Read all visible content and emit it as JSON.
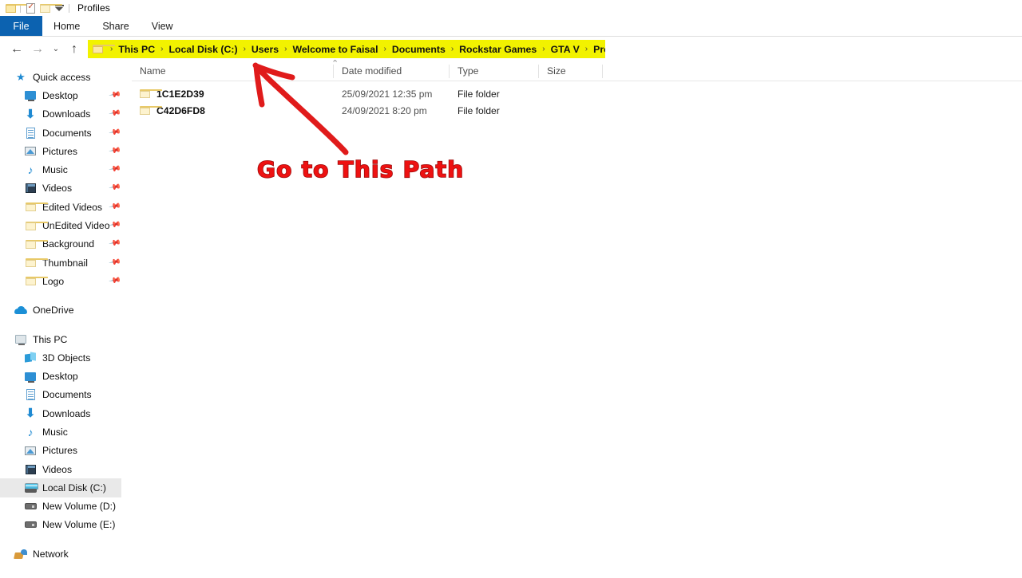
{
  "window": {
    "title": "Profiles",
    "quick_access_toolbar": [
      {
        "name": "folder-icon"
      },
      {
        "name": "properties-icon"
      },
      {
        "name": "new-folder-icon"
      },
      {
        "name": "customize-qat-chevron-icon"
      }
    ]
  },
  "ribbon": {
    "tabs": [
      {
        "label": "File",
        "active": true
      },
      {
        "label": "Home",
        "active": false
      },
      {
        "label": "Share",
        "active": false
      },
      {
        "label": "View",
        "active": false
      }
    ]
  },
  "navigation": {
    "back_icon": "←",
    "forward_icon": "→",
    "recent_icon": "⌄",
    "up_icon": "↑",
    "highlight_color": "#f2f200",
    "breadcrumb_separator": "›",
    "breadcrumbs": [
      {
        "label": "This PC"
      },
      {
        "label": "Local Disk (C:)"
      },
      {
        "label": "Users"
      },
      {
        "label": "Welcome to Faisal"
      },
      {
        "label": "Documents"
      },
      {
        "label": "Rockstar Games"
      },
      {
        "label": "GTA V"
      },
      {
        "label": "Profiles"
      }
    ]
  },
  "sidebar": {
    "groups": [
      {
        "root": {
          "label": "Quick access",
          "icon": "star-pin-icon",
          "selected": false
        },
        "items": [
          {
            "label": "Desktop",
            "icon": "desktop-monitor-icon",
            "pinned": true
          },
          {
            "label": "Downloads",
            "icon": "download-arrow-icon",
            "pinned": true
          },
          {
            "label": "Documents",
            "icon": "document-icon",
            "pinned": true
          },
          {
            "label": "Pictures",
            "icon": "picture-icon",
            "pinned": true
          },
          {
            "label": "Music",
            "icon": "music-note-icon",
            "pinned": true
          },
          {
            "label": "Videos",
            "icon": "video-film-icon",
            "pinned": true
          },
          {
            "label": "Edited Videos",
            "icon": "folder-icon",
            "pinned": true
          },
          {
            "label": "UnEdited Video",
            "icon": "folder-icon",
            "pinned": true
          },
          {
            "label": "Background",
            "icon": "folder-icon",
            "pinned": true
          },
          {
            "label": "Thumbnail",
            "icon": "folder-icon",
            "pinned": true
          },
          {
            "label": "Logo",
            "icon": "folder-icon",
            "pinned": true
          }
        ]
      },
      {
        "root": {
          "label": "OneDrive",
          "icon": "cloud-icon",
          "selected": false
        },
        "items": []
      },
      {
        "root": {
          "label": "This PC",
          "icon": "this-pc-monitor-icon",
          "selected": false
        },
        "items": [
          {
            "label": "3D Objects",
            "icon": "3d-objects-icon",
            "pinned": false
          },
          {
            "label": "Desktop",
            "icon": "desktop-monitor-icon",
            "pinned": false
          },
          {
            "label": "Documents",
            "icon": "document-icon",
            "pinned": false
          },
          {
            "label": "Downloads",
            "icon": "download-arrow-icon",
            "pinned": false
          },
          {
            "label": "Music",
            "icon": "music-note-icon",
            "pinned": false
          },
          {
            "label": "Pictures",
            "icon": "picture-icon",
            "pinned": false
          },
          {
            "label": "Videos",
            "icon": "video-film-icon",
            "pinned": false
          },
          {
            "label": "Local Disk (C:)",
            "icon": "local-disk-icon",
            "pinned": false,
            "selected": true
          },
          {
            "label": "New Volume (D:)",
            "icon": "drive-icon",
            "pinned": false
          },
          {
            "label": "New Volume (E:)",
            "icon": "drive-icon",
            "pinned": false
          }
        ]
      },
      {
        "root": {
          "label": "Network",
          "icon": "network-icon",
          "selected": false
        },
        "items": []
      }
    ]
  },
  "file_list": {
    "columns": [
      {
        "label": "Name",
        "sorted": "asc",
        "sort_indicator": "⌃"
      },
      {
        "label": "Date modified",
        "sorted": null
      },
      {
        "label": "Type",
        "sorted": null
      },
      {
        "label": "Size",
        "sorted": null
      }
    ],
    "rows": [
      {
        "name": "1C1E2D39",
        "date_modified": "25/09/2021 12:35 pm",
        "type": "File folder",
        "size": "",
        "icon": "folder-icon"
      },
      {
        "name": "C42D6FD8",
        "date_modified": "24/09/2021 8:20 pm",
        "type": "File folder",
        "size": "",
        "icon": "folder-icon"
      }
    ]
  },
  "annotations": {
    "callout_text": "Go to This Path",
    "callout_color": "#ee1111",
    "arrow_color": "#e01b1b",
    "arrow_description": "hand-drawn-arrow-pointing-to-address-bar"
  }
}
